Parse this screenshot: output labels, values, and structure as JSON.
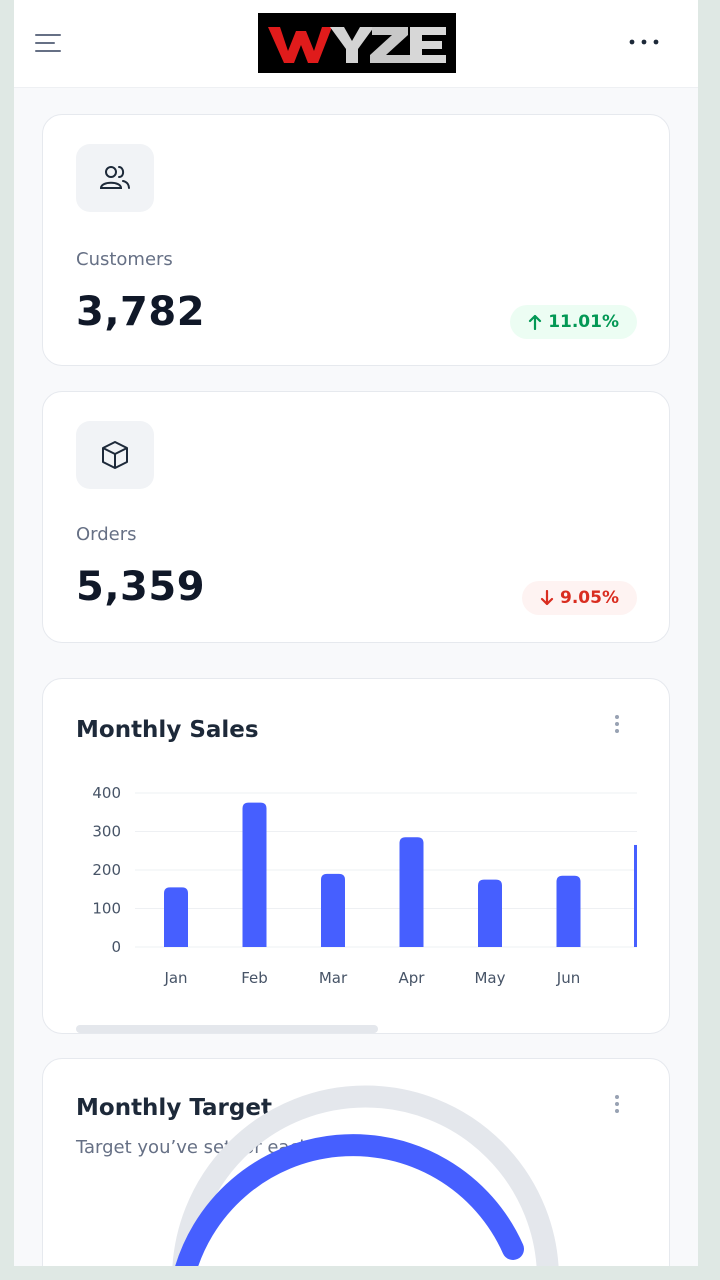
{
  "header": {
    "logo_text": "WYZE",
    "menu_icon": "hamburger-icon",
    "more_icon": "more-horizontal-icon"
  },
  "customers": {
    "icon": "users-icon",
    "label": "Customers",
    "value": "3,782",
    "change": "11.01%",
    "direction": "up",
    "color": "#039855"
  },
  "orders": {
    "icon": "box-icon",
    "label": "Orders",
    "value": "5,359",
    "change": "9.05%",
    "direction": "down",
    "color": "#d92d20"
  },
  "monthly_sales": {
    "title": "Monthly Sales",
    "menu_icon": "kebab-icon",
    "bar_color": "#465fff",
    "scroll_position": 0.45
  },
  "chart_data": {
    "type": "bar",
    "title": "Monthly Sales",
    "categories": [
      "Jan",
      "Feb",
      "Mar",
      "Apr",
      "May",
      "Jun"
    ],
    "values": [
      155,
      375,
      190,
      285,
      175,
      185
    ],
    "yticks": [
      "400",
      "300",
      "200",
      "100",
      "0"
    ],
    "ylim": [
      0,
      400
    ],
    "grid": true,
    "xlabel": "",
    "ylabel": ""
  },
  "monthly_target": {
    "title": "Monthly Target",
    "subtitle": "Target you’ve set for each month",
    "menu_icon": "kebab-icon",
    "gauge_color": "#465fff"
  }
}
